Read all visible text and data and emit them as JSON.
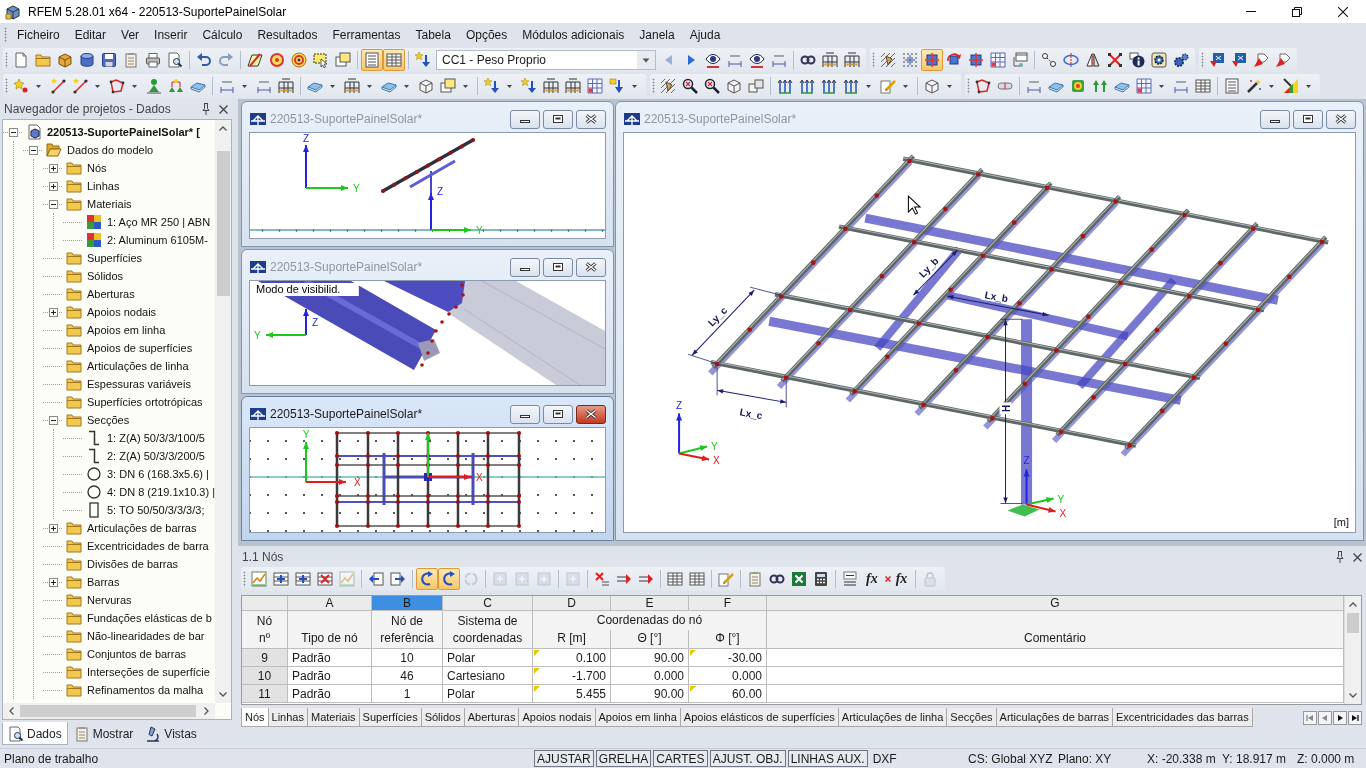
{
  "window": {
    "title": "RFEM 5.28.01 x64 - 220513-SuportePainelSolar"
  },
  "menu": [
    "Ficheiro",
    "Editar",
    "Ver",
    "Inserir",
    "Cálculo",
    "Resultados",
    "Ferramentas",
    "Tabela",
    "Opções",
    "Módulos adicionais",
    "Janela",
    "Ajuda"
  ],
  "toolbars": [
    {
      "buttons": [
        {
          "pressed": false
        },
        {
          "pressed": false
        },
        {
          "pressed": false
        },
        {
          "pressed": false
        },
        {
          "pressed": false
        },
        {
          "pressed": false
        },
        {
          "pressed": false
        },
        {
          "pressed": false
        },
        {
          "pressed": false
        },
        {
          "pressed": false
        },
        {
          "pressed": false
        },
        {
          "pressed": false
        },
        {
          "pressed": false
        },
        {
          "pressed": false
        },
        {
          "pressed": false
        },
        {
          "pressed": true
        },
        {
          "pressed": true
        },
        {
          "pressed": false
        },
        {
          "pressed": false
        },
        {
          "pressed": false
        },
        {
          "pressed": false
        },
        {
          "pressed": false
        },
        {
          "pressed": false
        },
        {
          "pressed": false
        },
        {
          "pressed": false
        },
        {
          "pressed": false
        },
        {
          "pressed": false
        },
        {
          "pressed": false
        },
        {
          "pressed": false
        },
        {
          "pressed": true
        },
        {
          "pressed": false
        },
        {
          "pressed": false
        },
        {
          "pressed": false
        },
        {
          "pressed": false
        },
        {
          "pressed": false
        },
        {
          "pressed": false
        },
        {
          "pressed": false
        },
        {
          "pressed": false
        },
        {
          "pressed": false
        },
        {
          "pressed": false
        },
        {
          "pressed": false
        },
        {
          "pressed": false
        },
        {
          "pressed": false
        },
        {
          "pressed": false
        },
        {
          "pressed": false
        }
      ]
    },
    {
      "buttons": [
        {
          "pressed": false
        },
        {
          "pressed": false
        },
        {
          "pressed": false
        },
        {
          "pressed": false
        },
        {
          "pressed": false
        },
        {
          "pressed": false
        },
        {
          "pressed": false
        },
        {
          "pressed": false
        },
        {
          "pressed": false
        },
        {
          "pressed": false
        },
        {
          "pressed": false
        },
        {
          "pressed": false
        },
        {
          "pressed": false
        },
        {
          "pressed": false
        },
        {
          "pressed": false
        },
        {
          "pressed": false
        },
        {
          "pressed": false
        },
        {
          "pressed": false
        },
        {
          "pressed": false
        },
        {
          "pressed": false
        },
        {
          "pressed": false
        },
        {
          "pressed": false
        },
        {
          "pressed": false
        },
        {
          "pressed": false
        },
        {
          "pressed": false
        },
        {
          "pressed": false
        },
        {
          "pressed": false
        },
        {
          "pressed": false
        },
        {
          "pressed": false
        },
        {
          "pressed": false
        },
        {
          "pressed": false
        },
        {
          "pressed": false
        },
        {
          "pressed": false
        },
        {
          "pressed": false
        },
        {
          "pressed": false
        },
        {
          "pressed": false
        },
        {
          "pressed": false
        },
        {
          "pressed": false
        },
        {
          "pressed": false
        },
        {
          "pressed": false
        },
        {
          "pressed": false
        },
        {
          "pressed": false
        },
        {
          "pressed": false
        },
        {
          "pressed": false
        },
        {
          "pressed": false
        }
      ]
    }
  ],
  "load_case": {
    "value": "CC1 - Peso Proprio"
  },
  "navigator": {
    "title": "Navegador de projetos - Dados",
    "tree": [
      {
        "label": "220513-SuportePainelSolar* [",
        "kind": "project",
        "expanded": true,
        "children": [
          {
            "label": "Dados do modelo",
            "kind": "open_folder",
            "expanded": true,
            "children": [
              {
                "label": "Nós",
                "kind": "folder",
                "expanded": false
              },
              {
                "label": "Linhas",
                "kind": "folder",
                "expanded": false
              },
              {
                "label": "Materiais",
                "kind": "folder",
                "expanded": true,
                "children": [
                  {
                    "label": "1: Aço MR 250 | ABN",
                    "kind": "material"
                  },
                  {
                    "label": "2: Aluminum 6105M-",
                    "kind": "material"
                  }
                ]
              },
              {
                "label": "Superfícies",
                "kind": "folder"
              },
              {
                "label": "Sólidos",
                "kind": "folder"
              },
              {
                "label": "Aberturas",
                "kind": "folder"
              },
              {
                "label": "Apoios nodais",
                "kind": "folder",
                "expanded": false
              },
              {
                "label": "Apoios em linha",
                "kind": "folder"
              },
              {
                "label": "Apoios de superfícies",
                "kind": "folder"
              },
              {
                "label": "Articulações de linha",
                "kind": "folder"
              },
              {
                "label": "Espessuras variáveis",
                "kind": "folder"
              },
              {
                "label": "Superfícies ortotrópicas",
                "kind": "folder"
              },
              {
                "label": "Secções",
                "kind": "folder",
                "expanded": true,
                "children": [
                  {
                    "label": "1: Z(A) 50/3/3/100/5",
                    "kind": "z_section"
                  },
                  {
                    "label": "2: Z(A) 50/3/3/200/5",
                    "kind": "z_section"
                  },
                  {
                    "label": "3: DN 6 (168.3x5.6) |",
                    "kind": "pipe_section"
                  },
                  {
                    "label": "4: DN 8 (219.1x10.3) |",
                    "kind": "pipe_section"
                  },
                  {
                    "label": "5: TO 50/50/3/3/3/3;",
                    "kind": "box_section"
                  }
                ]
              },
              {
                "label": "Articulações de barras",
                "kind": "folder",
                "expanded": false
              },
              {
                "label": "Excentricidades de barra",
                "kind": "folder"
              },
              {
                "label": "Divisões de barras",
                "kind": "folder"
              },
              {
                "label": "Barras",
                "kind": "folder",
                "expanded": false
              },
              {
                "label": "Nervuras",
                "kind": "folder"
              },
              {
                "label": "Fundações elásticas de b",
                "kind": "folder"
              },
              {
                "label": "Não-linearidades de bar",
                "kind": "folder"
              },
              {
                "label": "Conjuntos de barras",
                "kind": "folder"
              },
              {
                "label": "Interseções de superfície",
                "kind": "folder"
              },
              {
                "label": "Refinamentos da malha",
                "kind": "folder"
              }
            ]
          }
        ]
      }
    ],
    "tabs": [
      {
        "label": "Dados",
        "selected": true
      },
      {
        "label": "Mostrar",
        "selected": false
      },
      {
        "label": "Vistas",
        "selected": false
      }
    ]
  },
  "views": [
    {
      "kind": "side",
      "title": "220513-SuportePainelSolar*",
      "active": false,
      "axis_labels": [
        "Z",
        "Y",
        "Z",
        "Y"
      ]
    },
    {
      "kind": "closeup",
      "title": "220513-SuportePainelSolar*",
      "active": false,
      "note": "Modo de visibilid.",
      "axis_labels": [
        "Z",
        "Y"
      ]
    },
    {
      "kind": "top",
      "title": "220513-SuportePainelSolar*",
      "active": true,
      "axis_labels": [
        "Y",
        "X",
        "X"
      ]
    },
    {
      "kind": "iso",
      "title": "220513-SuportePainelSolar*",
      "active": false,
      "axis_labels": [
        "Z",
        "Y",
        "X",
        "Z",
        "Y",
        "X"
      ],
      "dimension_labels": [
        "Ly_c",
        "Lx_c",
        "Ly_b",
        "Lx_b",
        "H"
      ],
      "unit": "[m]"
    }
  ],
  "table": {
    "title": "1.1 Nós",
    "toolbar": [
      {
        "pressed": false,
        "disabled": false
      },
      {
        "pressed": false,
        "disabled": false
      },
      {
        "pressed": false,
        "disabled": false
      },
      {
        "pressed": false,
        "disabled": false
      },
      {
        "pressed": false,
        "disabled": true
      },
      {
        "pressed": false,
        "disabled": false
      },
      {
        "pressed": false,
        "disabled": false
      },
      {
        "pressed": true,
        "disabled": false
      },
      {
        "pressed": true,
        "disabled": false
      },
      {
        "pressed": false,
        "disabled": true
      },
      {
        "pressed": false,
        "disabled": true
      },
      {
        "pressed": false,
        "disabled": true
      },
      {
        "pressed": false,
        "disabled": true
      },
      {
        "pressed": false,
        "disabled": true
      },
      {
        "pressed": false,
        "disabled": false
      },
      {
        "pressed": false,
        "disabled": false
      },
      {
        "pressed": false,
        "disabled": false
      },
      {
        "pressed": false,
        "disabled": false
      },
      {
        "pressed": false,
        "disabled": false
      },
      {
        "pressed": false,
        "disabled": false
      },
      {
        "pressed": false,
        "disabled": false
      },
      {
        "pressed": false,
        "disabled": false
      },
      {
        "pressed": false,
        "disabled": false
      },
      {
        "pressed": false,
        "disabled": false
      },
      {
        "pressed": false,
        "disabled": false
      },
      {
        "label": "fx",
        "pressed": false,
        "disabled": false
      },
      {
        "label": "fx",
        "pressed": false,
        "disabled": false
      },
      {
        "pressed": false,
        "disabled": true
      }
    ],
    "row_header": {
      "heading": "Nó nº"
    },
    "columns": [
      {
        "letter": "A",
        "heading": "Tipo de nó",
        "selected": false
      },
      {
        "letter": "B",
        "heading": "Nó de referência",
        "selected": true
      },
      {
        "letter": "C",
        "heading": "Sistema de coordenadas",
        "selected": false
      },
      {
        "group": "Coordenadas do nó",
        "columns": [
          {
            "letter": "D",
            "heading": "R [m]",
            "selected": false
          },
          {
            "letter": "E",
            "heading": "Θ [°]",
            "selected": false
          },
          {
            "letter": "F",
            "heading": "Φ [°]",
            "selected": false
          }
        ]
      },
      {
        "letter": "G",
        "heading": "Comentário",
        "selected": false
      }
    ],
    "rows": [
      {
        "number": "9",
        "cells": [
          {
            "text": "Padrão",
            "marker": false
          },
          {
            "text": "10",
            "marker": false
          },
          {
            "text": "Polar",
            "marker": false
          },
          {
            "text": "0.100",
            "marker": true
          },
          {
            "text": "90.00",
            "marker": false
          },
          {
            "text": "-30.00",
            "marker": true
          }
        ]
      },
      {
        "number": "10",
        "cells": [
          {
            "text": "Padrão",
            "marker": false
          },
          {
            "text": "46",
            "marker": false
          },
          {
            "text": "Cartesiano",
            "marker": false
          },
          {
            "text": "-1.700",
            "marker": true
          },
          {
            "text": "0.000",
            "marker": false
          },
          {
            "text": "0.000",
            "marker": false
          }
        ]
      },
      {
        "number": "11",
        "cells": [
          {
            "text": "Padrão",
            "marker": false
          },
          {
            "text": "1",
            "marker": false
          },
          {
            "text": "Polar",
            "marker": false
          },
          {
            "text": "5.455",
            "marker": true
          },
          {
            "text": "90.00",
            "marker": false
          },
          {
            "text": "60.00",
            "marker": true
          }
        ]
      }
    ],
    "tabs": [
      {
        "label": "Nós",
        "selected": true
      },
      {
        "label": "Linhas",
        "selected": false
      },
      {
        "label": "Materiais",
        "selected": false
      },
      {
        "label": "Superfícies",
        "selected": false
      },
      {
        "label": "Sólidos",
        "selected": false
      },
      {
        "label": "Aberturas",
        "selected": false
      },
      {
        "label": "Apoios nodais",
        "selected": false
      },
      {
        "label": "Apoios em linha",
        "selected": false
      },
      {
        "label": "Apoios elásticos de superfícies",
        "selected": false
      },
      {
        "label": "Articulações de linha",
        "selected": false
      },
      {
        "label": "Secções",
        "selected": false
      },
      {
        "label": "Articulações de barras",
        "selected": false
      },
      {
        "label": "Excentricidades das barras",
        "selected": false
      }
    ]
  },
  "status_bar": {
    "text": "Plano de trabalho",
    "toggles": [
      {
        "label": "AJUSTAR",
        "on": true
      },
      {
        "label": "GRELHA",
        "on": true
      },
      {
        "label": "CARTES",
        "on": true
      },
      {
        "label": "AJUST. OBJ.",
        "on": true
      },
      {
        "label": "LINHAS AUX.",
        "on": true
      },
      {
        "label": "DXF",
        "on": false
      }
    ],
    "fields": [
      "CS: Global XYZ",
      "Plano: XY",
      "X: -20.338 m",
      "Y: 18.917 m",
      "Z: 0.000 m"
    ]
  }
}
